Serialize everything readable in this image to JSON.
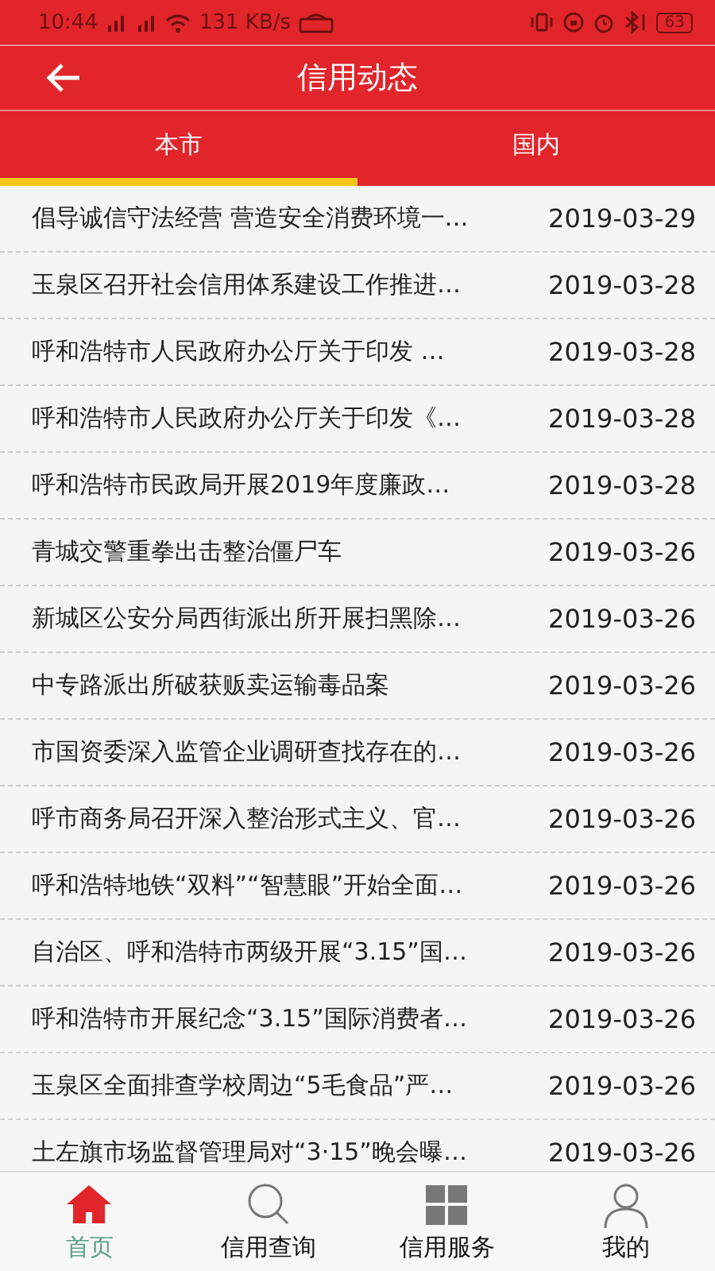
{
  "status_bar": {
    "time": "10:44",
    "speed": "131 KB/s",
    "battery": "63"
  },
  "header": {
    "title": "信用动态"
  },
  "tabs": [
    {
      "label": "本市",
      "selected": true
    },
    {
      "label": "国内",
      "selected": false
    }
  ],
  "news": [
    {
      "title": "倡导诚信守法经营 营造安全消费环境一…",
      "date": "2019-03-29"
    },
    {
      "title": "玉泉区召开社会信用体系建设工作推进…",
      "date": "2019-03-28"
    },
    {
      "title": "呼和浩特市人民政府办公厅关于印发 …",
      "date": "2019-03-28"
    },
    {
      "title": "呼和浩特市人民政府办公厅关于印发《…",
      "date": "2019-03-28"
    },
    {
      "title": "呼和浩特市民政局开展2019年度廉政…",
      "date": "2019-03-28"
    },
    {
      "title": "青城交警重拳出击整治僵尸车",
      "date": "2019-03-26"
    },
    {
      "title": "新城区公安分局西街派出所开展扫黑除…",
      "date": "2019-03-26"
    },
    {
      "title": "中专路派出所破获贩卖运输毒品案",
      "date": "2019-03-26"
    },
    {
      "title": "市国资委深入监管企业调研查找存在的…",
      "date": "2019-03-26"
    },
    {
      "title": "呼市商务局召开深入整治形式主义、官…",
      "date": "2019-03-26"
    },
    {
      "title": "呼和浩特地铁“双料”“智慧眼”开始全面…",
      "date": "2019-03-26"
    },
    {
      "title": "自治区、呼和浩特市两级开展“3.15”国…",
      "date": "2019-03-26"
    },
    {
      "title": "呼和浩特市开展纪念“3.15”国际消费者…",
      "date": "2019-03-26"
    },
    {
      "title": "玉泉区全面排查学校周边“5毛食品”严…",
      "date": "2019-03-26"
    },
    {
      "title": "土左旗市场监督管理局对“3·15”晚会曝…",
      "date": "2019-03-26"
    }
  ],
  "bottom_nav": [
    {
      "kind": "home",
      "label": "首页",
      "selected": true
    },
    {
      "kind": "search",
      "label": "信用查询",
      "selected": false
    },
    {
      "kind": "grid",
      "label": "信用服务",
      "selected": false
    },
    {
      "kind": "person",
      "label": "我的",
      "selected": false
    }
  ]
}
